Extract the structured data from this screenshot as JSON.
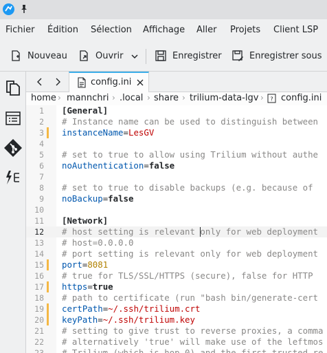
{
  "window": {
    "app_icon": "kate-icon",
    "pin_icon": "pin-icon"
  },
  "menu": [
    "Fichier",
    "Édition",
    "Sélection",
    "Affichage",
    "Aller",
    "Projets",
    "Client LSP"
  ],
  "toolbar": {
    "new_label": "Nouveau",
    "open_label": "Ouvrir",
    "save_label": "Enregistrer",
    "save_as_label": "Enregistrer sous"
  },
  "tab": {
    "label": "config.ini"
  },
  "breadcrumb": [
    "home",
    "mannchri",
    ".local",
    "share",
    "trilium-data-lgv",
    "config.ini"
  ],
  "editor": {
    "current_line": 12,
    "lines": [
      {
        "n": "1",
        "mod": false,
        "html": "<span class='c-section'>[General]</span>"
      },
      {
        "n": "2",
        "mod": false,
        "html": "<span class='c-comment'># Instance name can be used to distinguish between</span>"
      },
      {
        "n": "3",
        "mod": true,
        "html": "<span class='c-key'>instanceName</span><span class='c-eq'>=</span><span class='c-val'>LesGV</span>"
      },
      {
        "n": "4",
        "mod": false,
        "html": ""
      },
      {
        "n": "5",
        "mod": false,
        "html": "<span class='c-comment'># set to true to allow using Trilium without authe</span>"
      },
      {
        "n": "6",
        "mod": false,
        "html": "<span class='c-key'>noAuthentication</span><span class='c-eq'>=</span><span class='c-bool'>false</span>"
      },
      {
        "n": "7",
        "mod": false,
        "html": ""
      },
      {
        "n": "8",
        "mod": false,
        "html": "<span class='c-comment'># set to true to disable backups (e.g. because of </span>"
      },
      {
        "n": "9",
        "mod": false,
        "html": "<span class='c-key'>noBackup</span><span class='c-eq'>=</span><span class='c-bool'>false</span>"
      },
      {
        "n": "10",
        "mod": false,
        "html": ""
      },
      {
        "n": "11",
        "mod": false,
        "html": "<span class='c-section'>[Network]</span>"
      },
      {
        "n": "12",
        "mod": false,
        "html": "<span class='c-comment'># host setting is relevant only for web deployment</span>"
      },
      {
        "n": "13",
        "mod": false,
        "html": "<span class='c-comment'># host=0.0.0.0</span>"
      },
      {
        "n": "14",
        "mod": false,
        "html": "<span class='c-comment'># port setting is relevant only for web deployment</span>"
      },
      {
        "n": "15",
        "mod": true,
        "html": "<span class='c-key'>port</span><span class='c-eq'>=</span><span class='c-num'>8081</span>"
      },
      {
        "n": "16",
        "mod": false,
        "html": "<span class='c-comment'># true for TLS/SSL/HTTPS (secure), false for HTTP </span>"
      },
      {
        "n": "17",
        "mod": true,
        "html": "<span class='c-key'>https</span><span class='c-eq'>=</span><span class='c-bool'>true</span>"
      },
      {
        "n": "18",
        "mod": false,
        "html": "<span class='c-comment'># path to certificate (run \"bash bin/generate-cert</span>"
      },
      {
        "n": "19",
        "mod": true,
        "html": "<span class='c-key'>certPath</span><span class='c-eq'>=</span><span class='c-val'>~/.ssh/trilium.crt</span>"
      },
      {
        "n": "20",
        "mod": true,
        "html": "<span class='c-key'>keyPath</span><span class='c-eq'>=</span><span class='c-val'>~/.ssh/trilium.key</span>"
      },
      {
        "n": "21",
        "mod": false,
        "html": "<span class='c-comment'># setting to give trust to reverse proxies, a comma</span>"
      },
      {
        "n": "22",
        "mod": false,
        "html": "<span class='c-comment'># alternatively 'true' will make use of the leftmos</span>"
      },
      {
        "n": "23",
        "mod": false,
        "html": "<span class='c-comment'># Trilium (which is hop 0) and the first trusted re</span>"
      }
    ]
  }
}
